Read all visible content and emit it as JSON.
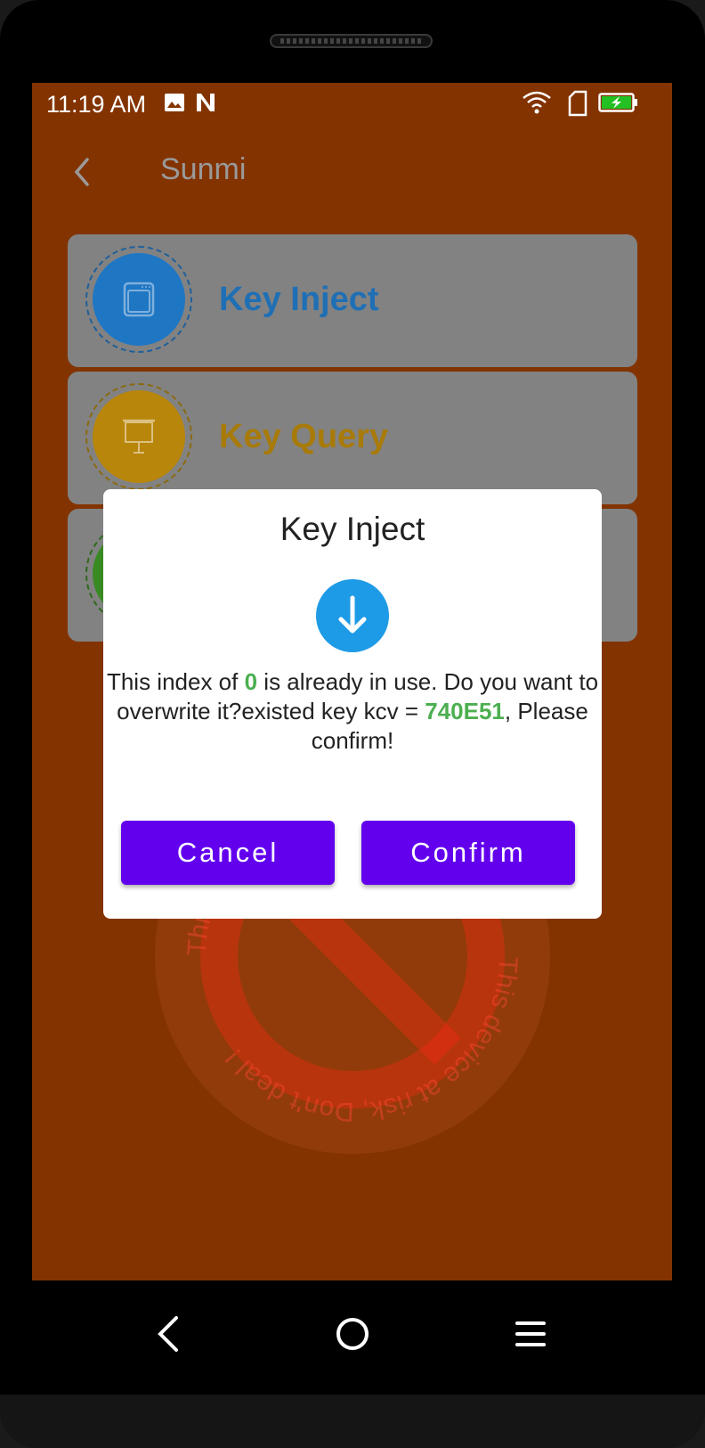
{
  "status_bar": {
    "time": "11:19 AM",
    "icons": [
      "image-icon",
      "n-notification-icon",
      "wifi-icon",
      "sim-card-icon",
      "battery-charging-icon"
    ],
    "battery_color": "#22c022"
  },
  "app_bar": {
    "title": "Sunmi",
    "back_icon": "chevron-left-icon"
  },
  "menu": {
    "items": [
      {
        "label": "Key Inject",
        "icon": "window-icon",
        "color": "#1f77c4"
      },
      {
        "label": "Key Query",
        "icon": "presentation-board-icon",
        "color": "#b8860b"
      },
      {
        "label": "",
        "icon": "",
        "color": "#3a8a24"
      }
    ]
  },
  "dialog": {
    "title": "Key Inject",
    "icon": "download-arrow-icon",
    "accent_color": "#1e9be6",
    "message_part1": "This index of ",
    "index_value": "0",
    "message_part2": " is already in use. Do you want to overwrite it?existed key kcv = ",
    "kcv_value": "740E51",
    "message_part3": ", Please confirm!",
    "highlight_color": "#4caf50",
    "cancel_label": "Cancel",
    "confirm_label": "Confirm",
    "button_color": "#6200ee"
  },
  "watermark": {
    "text": "This device at risk, Don't deal !"
  },
  "nav_bar": {
    "icons": [
      "back-triangle-icon",
      "home-circle-icon",
      "menu-lines-icon"
    ]
  }
}
